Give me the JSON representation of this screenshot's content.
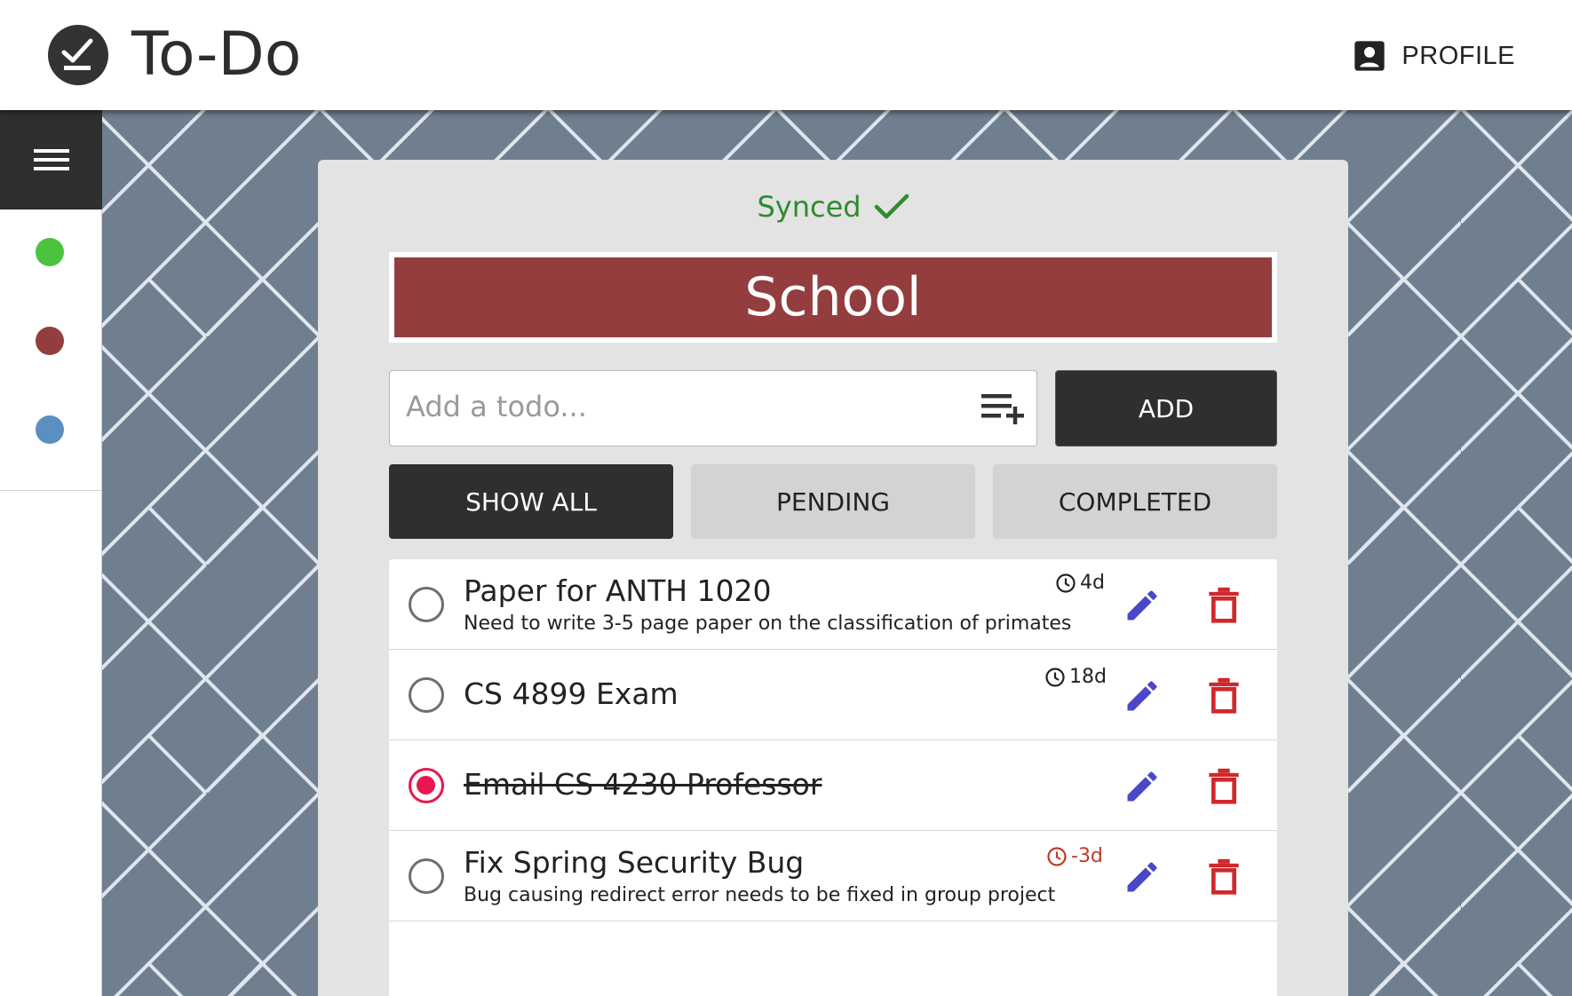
{
  "header": {
    "app_title": "To-Do",
    "logo_icon": "check-circle-icon",
    "profile_label": "PROFILE",
    "profile_icon": "account-box-icon"
  },
  "sidebar": {
    "menu_icon": "hamburger-menu-icon",
    "lists": [
      {
        "name": "green-list",
        "color": "#4cc33f"
      },
      {
        "name": "red-list",
        "color": "#943d3e"
      },
      {
        "name": "blue-list",
        "color": "#5b8fc2"
      }
    ]
  },
  "main": {
    "sync_status": "Synced",
    "list_title": "School",
    "list_color": "#943d3e",
    "add_input_placeholder": "Add a todo...",
    "add_button_label": "ADD",
    "filters": [
      {
        "label": "SHOW ALL",
        "active": true
      },
      {
        "label": "PENDING",
        "active": false
      },
      {
        "label": "COMPLETED",
        "active": false
      }
    ],
    "todos": [
      {
        "title": "Paper for ANTH 1020",
        "description": "Need to write 3-5 page paper on the classification of primates",
        "due": "4d",
        "completed": false,
        "overdue": false
      },
      {
        "title": "CS 4899 Exam",
        "description": "",
        "due": "18d",
        "completed": false,
        "overdue": false
      },
      {
        "title": "Email CS 4230 Professor",
        "description": "",
        "due": "",
        "completed": true,
        "overdue": false
      },
      {
        "title": "Fix Spring Security Bug",
        "description": "Bug causing redirect error needs to be fixed in group project",
        "due": "-3d",
        "completed": false,
        "overdue": true
      }
    ]
  },
  "colors": {
    "accent_dark": "#2f2f2f",
    "synced_green": "#2e8b2e",
    "edit_blue": "#4a48c8",
    "delete_red": "#d0282c",
    "checked_pink": "#e8174f",
    "background_pattern": "#6f7f8f"
  }
}
